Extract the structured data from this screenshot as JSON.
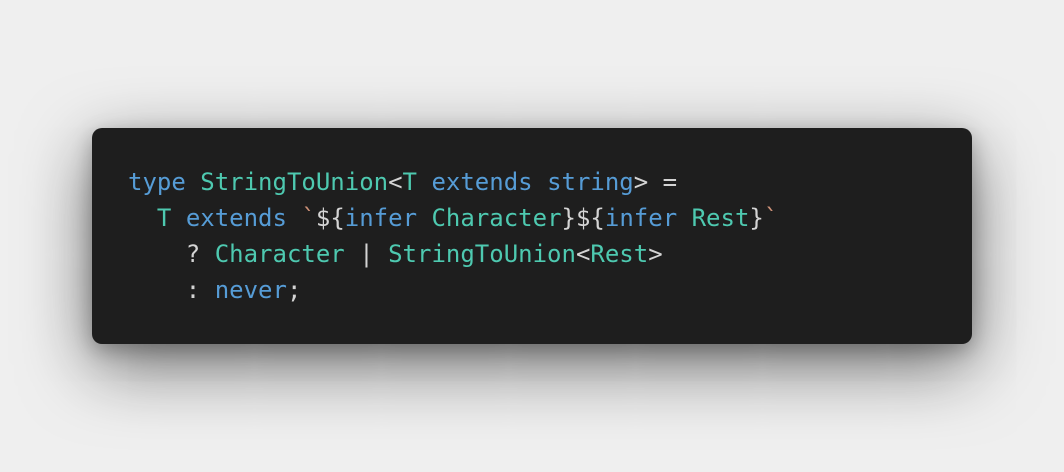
{
  "colors": {
    "page_background": "#efefef",
    "editor_background": "#1e1e1e",
    "keyword": "#569cd6",
    "type": "#4ec9b0",
    "punctuation": "#d4d4d4",
    "string_delimiter": "#ce9178"
  },
  "code": {
    "lines": [
      {
        "tokens": [
          {
            "text": "type",
            "kind": "keyword"
          },
          {
            "text": " ",
            "kind": "punct"
          },
          {
            "text": "StringToUnion",
            "kind": "type"
          },
          {
            "text": "<",
            "kind": "punct"
          },
          {
            "text": "T",
            "kind": "type"
          },
          {
            "text": " ",
            "kind": "punct"
          },
          {
            "text": "extends",
            "kind": "keyword"
          },
          {
            "text": " ",
            "kind": "punct"
          },
          {
            "text": "string",
            "kind": "keyword"
          },
          {
            "text": "> =",
            "kind": "punct"
          }
        ]
      },
      {
        "tokens": [
          {
            "text": "  ",
            "kind": "punct"
          },
          {
            "text": "T",
            "kind": "type"
          },
          {
            "text": " ",
            "kind": "punct"
          },
          {
            "text": "extends",
            "kind": "keyword"
          },
          {
            "text": " ",
            "kind": "punct"
          },
          {
            "text": "`",
            "kind": "backtick"
          },
          {
            "text": "${",
            "kind": "punct"
          },
          {
            "text": "infer",
            "kind": "keyword"
          },
          {
            "text": " ",
            "kind": "punct"
          },
          {
            "text": "Character",
            "kind": "type"
          },
          {
            "text": "}${",
            "kind": "punct"
          },
          {
            "text": "infer",
            "kind": "keyword"
          },
          {
            "text": " ",
            "kind": "punct"
          },
          {
            "text": "Rest",
            "kind": "type"
          },
          {
            "text": "}",
            "kind": "punct"
          },
          {
            "text": "`",
            "kind": "backtick"
          }
        ]
      },
      {
        "tokens": [
          {
            "text": "    ? ",
            "kind": "punct"
          },
          {
            "text": "Character",
            "kind": "type"
          },
          {
            "text": " | ",
            "kind": "punct"
          },
          {
            "text": "StringToUnion",
            "kind": "type"
          },
          {
            "text": "<",
            "kind": "punct"
          },
          {
            "text": "Rest",
            "kind": "type"
          },
          {
            "text": ">",
            "kind": "punct"
          }
        ]
      },
      {
        "tokens": [
          {
            "text": "    : ",
            "kind": "punct"
          },
          {
            "text": "never",
            "kind": "keyword"
          },
          {
            "text": ";",
            "kind": "punct"
          }
        ]
      }
    ]
  }
}
